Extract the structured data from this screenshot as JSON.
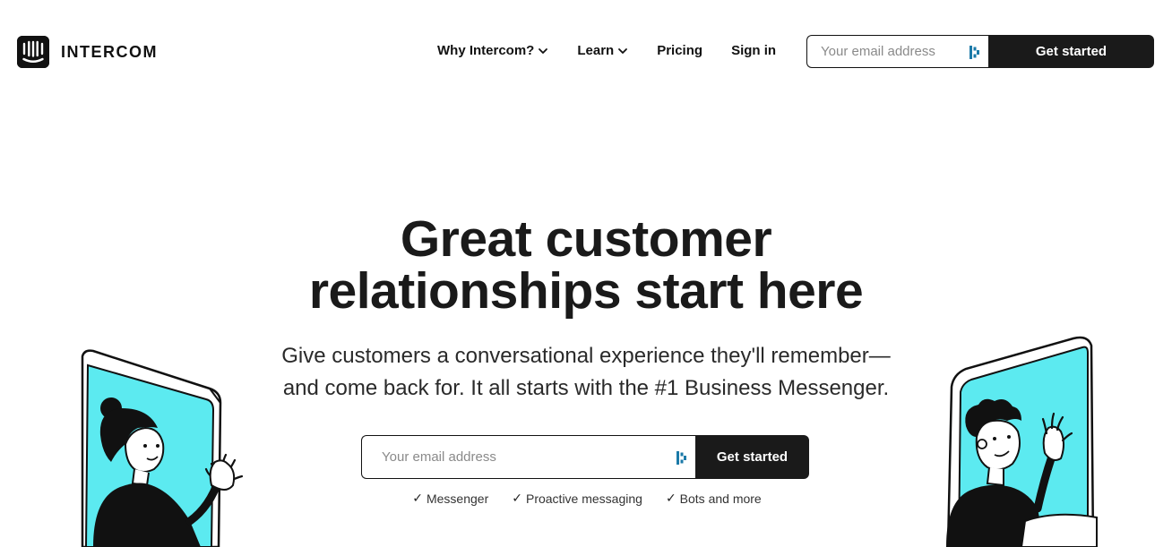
{
  "brand": {
    "name": "INTERCOM",
    "logo_icon": "intercom-logo-icon"
  },
  "nav": {
    "items": [
      {
        "label": "Why Intercom?",
        "has_dropdown": true
      },
      {
        "label": "Learn",
        "has_dropdown": true
      },
      {
        "label": "Pricing",
        "has_dropdown": false
      },
      {
        "label": "Sign in",
        "has_dropdown": false
      }
    ]
  },
  "top_form": {
    "placeholder": "Your email address",
    "button_label": "Get started",
    "input_icon": "password-manager-icon"
  },
  "hero": {
    "headline_line1": "Great customer",
    "headline_line2": "relationships start here",
    "sub_line1": "Give customers a conversational experience they'll remember—",
    "sub_line2": "and come back for. It all starts with the #1 Business Messenger.",
    "form": {
      "placeholder": "Your email address",
      "button_label": "Get started",
      "input_icon": "password-manager-icon"
    },
    "features": [
      "Messenger",
      "Proactive messaging",
      "Bots and more"
    ],
    "feature_icon": "checkmark-icon"
  },
  "illustrations": {
    "left": "woman-waving-from-window-illustration",
    "right": "man-waving-from-window-illustration"
  },
  "colors": {
    "accent_cyan": "#5ceaf0",
    "dark": "#1a1a1a",
    "pw_icon": "#1b7aa8"
  }
}
